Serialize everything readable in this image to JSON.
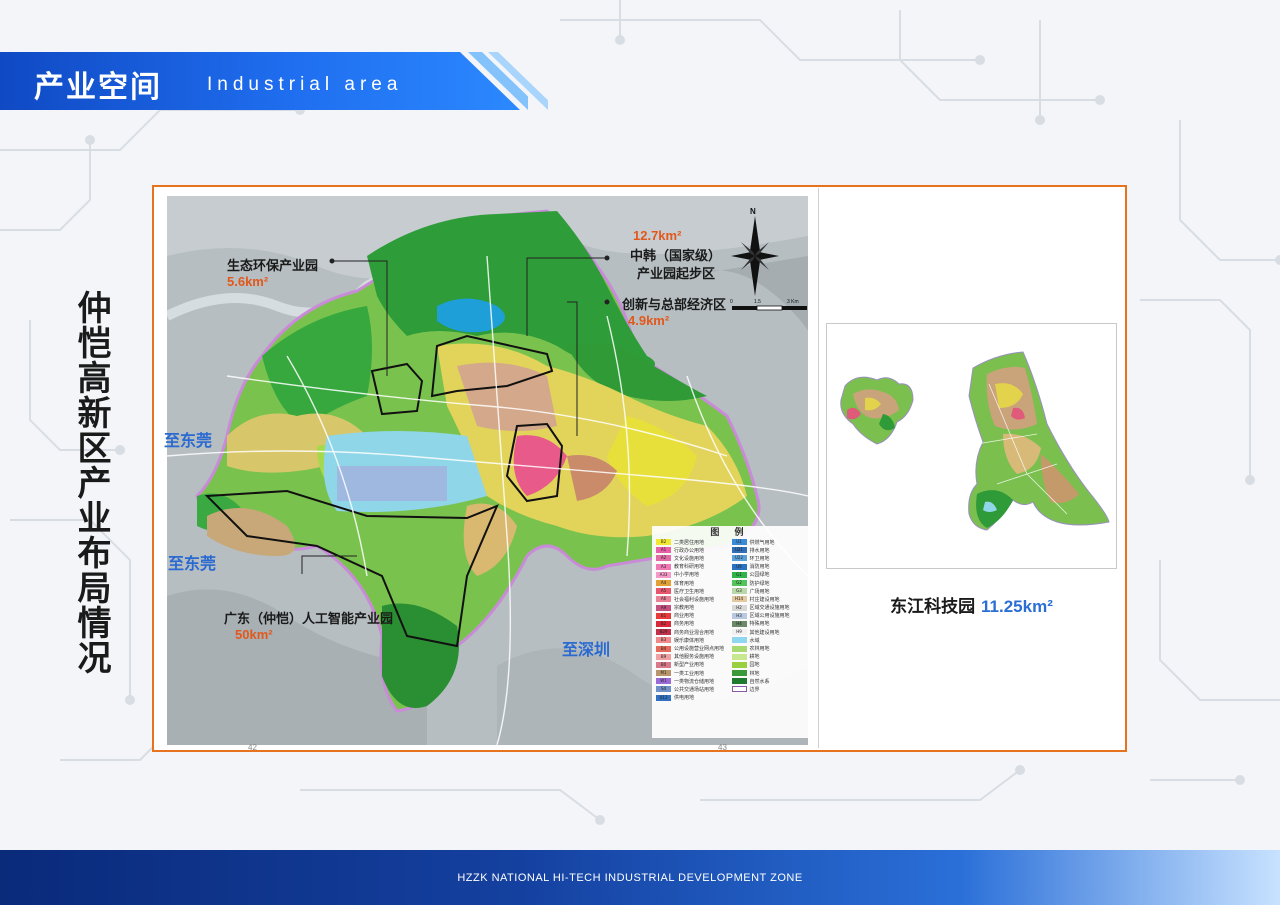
{
  "header": {
    "title": "产业空间",
    "subtitle": "Industrial area"
  },
  "side_title": "仲恺高新区产业布局情况",
  "map": {
    "zones": [
      {
        "name": "生态环保产业园",
        "area": "5.6km²"
      },
      {
        "name": "中韩（国家级）",
        "name2": "产业园起步区",
        "area": "12.7km²"
      },
      {
        "name": "创新与总部经济区",
        "area": "4.9km²"
      },
      {
        "name": "广东（仲恺）人工智能产业园",
        "area": "50km²"
      }
    ],
    "directions": [
      "至东莞",
      "至东莞",
      "至深圳"
    ],
    "compass": "N",
    "scale": [
      "0",
      "1.5",
      "3 Km"
    ],
    "page_numbers": [
      "42",
      "43"
    ],
    "legend": {
      "title": "图 例",
      "items": [
        {
          "code": "B2",
          "label": "二类居住用地",
          "color": "#f2e830"
        },
        {
          "code": "U1",
          "label": "供燃气用地",
          "color": "#3a8ad6"
        },
        {
          "code": "A1",
          "label": "行政办公用地",
          "color": "#e85fa8"
        },
        {
          "code": "U21",
          "label": "排水用地",
          "color": "#2f6fb8"
        },
        {
          "code": "A2",
          "label": "文化设施用地",
          "color": "#e26aa5"
        },
        {
          "code": "U22",
          "label": "环卫用地",
          "color": "#5aa0d8"
        },
        {
          "code": "A3",
          "label": "教育科研用地",
          "color": "#f07ab5"
        },
        {
          "code": "U9",
          "label": "消防用地",
          "color": "#2a72c0"
        },
        {
          "code": "A33",
          "label": "中小学用地",
          "color": "#f59ac8"
        },
        {
          "code": "G1",
          "label": "公园绿地",
          "color": "#2fb34a"
        },
        {
          "code": "A4",
          "label": "体育用地",
          "color": "#e2a035"
        },
        {
          "code": "G2",
          "label": "防护绿地",
          "color": "#52c45a"
        },
        {
          "code": "A5",
          "label": "医疗卫生用地",
          "color": "#e8566e"
        },
        {
          "code": "G3",
          "label": "广场用地",
          "color": "#b8d8a8"
        },
        {
          "code": "A6",
          "label": "社会福利设施用地",
          "color": "#ea8296"
        },
        {
          "code": "H14",
          "label": "村庄建设用地",
          "color": "#e4c8a0"
        },
        {
          "code": "A9",
          "label": "宗教用地",
          "color": "#c45080"
        },
        {
          "code": "H2",
          "label": "区域交通设施用地",
          "color": "#d8d8d8"
        },
        {
          "code": "B1",
          "label": "商业用地",
          "color": "#e83a3a"
        },
        {
          "code": "H3",
          "label": "区域公用设施用地",
          "color": "#b8c8e0"
        },
        {
          "code": "B2",
          "label": "商务用地",
          "color": "#d8283a"
        },
        {
          "code": "H4",
          "label": "特殊用地",
          "color": "#6a8a6a"
        },
        {
          "code": "B29",
          "label": "商务商业混合用地",
          "color": "#c0304a"
        },
        {
          "code": "H9",
          "label": "其他建设用地",
          "color": "#f0f0f0"
        },
        {
          "code": "B3",
          "label": "娱乐康体用地",
          "color": "#f08a8a"
        },
        {
          "code": "",
          "label": "水域",
          "color": "#8fd6f0"
        },
        {
          "code": "B4",
          "label": "公用设施营业网点用地",
          "color": "#e66a5a"
        },
        {
          "code": "",
          "label": "农林用地",
          "color": "#a8d870"
        },
        {
          "code": "B9",
          "label": "其他服务设施用地",
          "color": "#f0a0a0"
        },
        {
          "code": "",
          "label": "耕地",
          "color": "#c8e890"
        },
        {
          "code": "B0",
          "label": "新型产业用地",
          "color": "#d8788a"
        },
        {
          "code": "",
          "label": "园地",
          "color": "#98d040"
        },
        {
          "code": "M1",
          "label": "一类工业用地",
          "color": "#b8956a"
        },
        {
          "code": "",
          "label": "林地",
          "color": "#3a9a3a"
        },
        {
          "code": "W1",
          "label": "一类物流仓储用地",
          "color": "#9a6ad8"
        },
        {
          "code": "",
          "label": "自然水系",
          "color": "#1f7a2f"
        },
        {
          "code": "S4",
          "label": "公共交通场站用地",
          "color": "#7090c8"
        },
        {
          "code": "",
          "label": "边界",
          "color": "#ffffff"
        },
        {
          "code": "U12",
          "label": "供电用地",
          "color": "#3070c0"
        }
      ]
    }
  },
  "inset": {
    "caption_name": "东江科技园",
    "caption_area": "11.25km²"
  },
  "footer": {
    "text": "HZZK NATIONAL HI-TECH INDUSTRIAL DEVELOPMENT ZONE"
  }
}
